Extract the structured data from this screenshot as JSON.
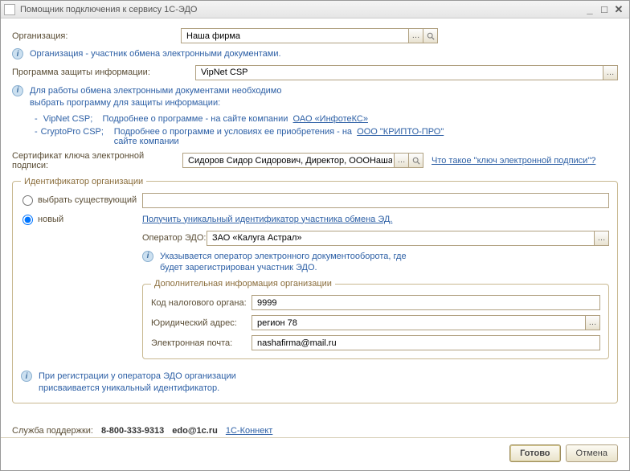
{
  "window": {
    "title": "Помощник подключения к сервису 1С-ЭДО"
  },
  "org": {
    "label": "Организация:",
    "value": "Наша фирма",
    "hint": "Организация - участник обмена электронными документами."
  },
  "crypto": {
    "label": "Программа защиты информации:",
    "value": "VipNet CSP",
    "hint1": "Для работы обмена электронными документами необходимо",
    "hint2": "выбрать программу для защиты информации:",
    "vipnet_name": "VipNet CSP;",
    "vipnet_more": "Подробнее о программе - на сайте компании",
    "vipnet_link": "ОАО «ИнфотеКС»",
    "cryptopro_name": "CryptoPro CSP;",
    "cryptopro_more1": "Подробнее о программе и условиях ее приобретения - на",
    "cryptopro_more2": "сайте компании",
    "cryptopro_link": "ООО \"КРИПТО-ПРО\""
  },
  "cert": {
    "label": "Сертификат ключа электронной подписи:",
    "value": "Сидоров Сидор Сидорович, Директор, ОООНаша фирм",
    "what_link": "Что такое \"ключ электронной подписи\"?"
  },
  "ident": {
    "legend": "Идентификатор организации",
    "existing_label": "выбрать существующий",
    "existing_value": "",
    "new_label": "новый",
    "get_link": "Получить уникальный идентификатор участника обмена ЭД.",
    "operator_label": "Оператор ЭДО:",
    "operator_value": "ЗАО «Калуга Астрал»",
    "operator_hint1": "Указывается оператор электронного документооборота, где",
    "operator_hint2": "будет зарегистрирован участник ЭДО.",
    "extra_legend": "Дополнительная информация организации",
    "tax_label": "Код налогового органа:",
    "tax_value": "9999",
    "addr_label": "Юридический адрес:",
    "addr_value": "регион 78",
    "email_label": "Электронная почта:",
    "email_value": "nashafirma@mail.ru",
    "reg_hint1": "При регистрации у оператора ЭДО организации",
    "reg_hint2": "присваивается уникальный идентификатор."
  },
  "support": {
    "label": "Служба поддержки:",
    "phone": "8-800-333-9313",
    "email": "edo@1c.ru",
    "connect": "1С-Коннект"
  },
  "buttons": {
    "ready": "Готово",
    "cancel": "Отмена"
  }
}
